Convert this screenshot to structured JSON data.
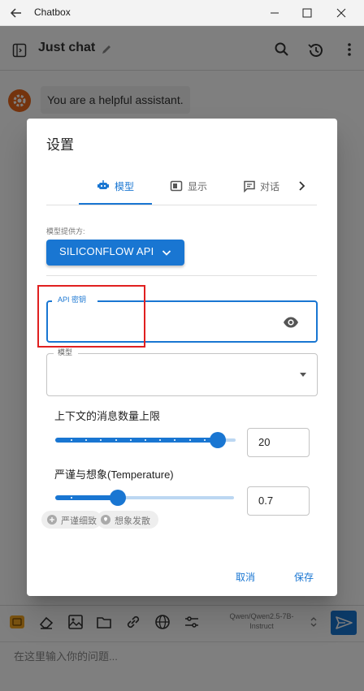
{
  "window": {
    "title": "Chatbox"
  },
  "header": {
    "chat_title": "Just chat"
  },
  "messages": [
    {
      "role": "system",
      "text": "You are a helpful assistant."
    }
  ],
  "toolbar": {
    "model_name": "Qwen/Qwen2.5-7B-Instruct"
  },
  "input": {
    "placeholder": "在这里输入你的问题..."
  },
  "dialog": {
    "title": "设置",
    "tabs": [
      {
        "label": "模型",
        "icon": "robot-icon",
        "active": true
      },
      {
        "label": "显示",
        "icon": "display-icon",
        "active": false
      },
      {
        "label": "对话",
        "icon": "chat-icon",
        "active": false
      }
    ],
    "provider": {
      "label": "模型提供方:",
      "value": "SILICONFLOW API"
    },
    "api_key": {
      "label": "API 密钥",
      "value": ""
    },
    "model": {
      "label": "模型",
      "value": ""
    },
    "context_limit": {
      "label": "上下文的消息数量上限",
      "value": "20",
      "slider_fraction": 0.9
    },
    "temperature": {
      "label": "严谨与想象(Temperature)",
      "value": "0.7",
      "slider_fraction": 0.35,
      "hints": [
        "严谨细致",
        "想象发散"
      ]
    },
    "actions": {
      "cancel": "取消",
      "save": "保存"
    }
  },
  "colors": {
    "accent": "#1976d2",
    "avatar": "#e8661a",
    "highlight": "#e02020"
  }
}
